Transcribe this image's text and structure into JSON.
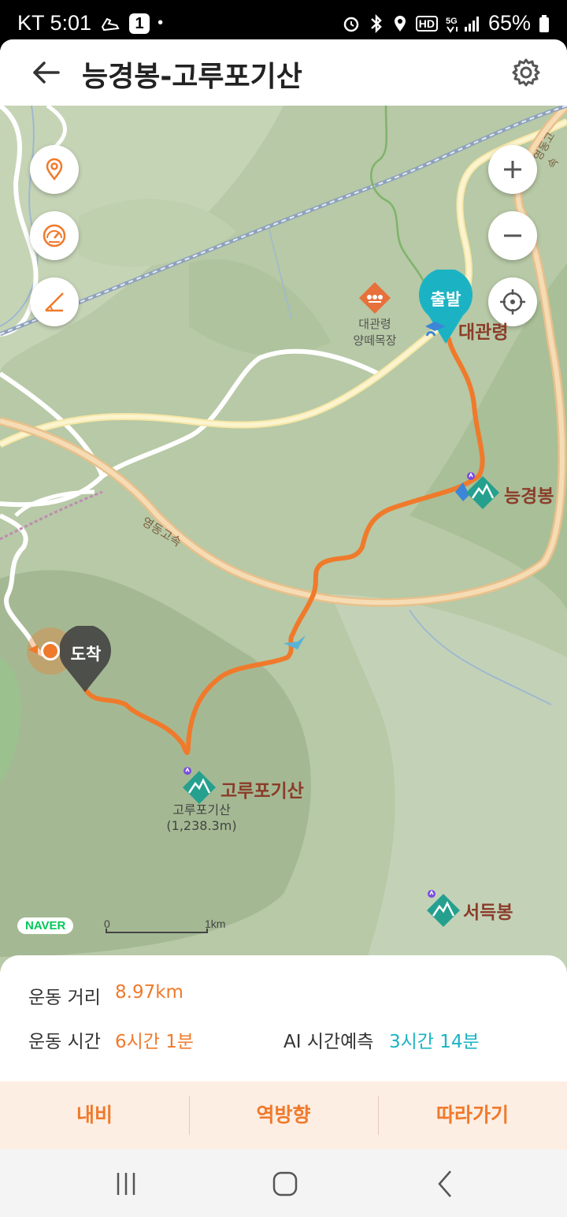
{
  "status_bar": {
    "carrier_time": "KT 5:01",
    "notification_count": "1",
    "network": "HD",
    "battery": "65%"
  },
  "header": {
    "title": "능경봉-고루포기산"
  },
  "map": {
    "labels": {
      "start_badge": "출발",
      "end_badge": "도착",
      "daegwallyeong": "대관령",
      "ranch_line1": "대관령",
      "ranch_line2": "양떼목장",
      "neunggyeongbong": "능경봉",
      "gorupogisan": "고루포기산",
      "gorupogisan_sub1": "고루포기산",
      "gorupogisan_sub2": "(1,238.3m)",
      "seodeukbong": "서득봉",
      "highway": "영동고속",
      "highway_right": "영동고속",
      "naver_logo": "NAVER",
      "scale_zero": "0",
      "scale_km": "1km"
    }
  },
  "stats": {
    "distance_label": "운동 거리",
    "distance_value": "8.97km",
    "time_label": "운동 시간",
    "time_value": "6시간 1분",
    "ai_label": "AI 시간예측",
    "ai_value": "3시간 14분"
  },
  "actions": {
    "navi": "내비",
    "reverse": "역방향",
    "follow": "따라가기"
  },
  "colors": {
    "route": "#f07a2b",
    "accent_teal": "#1bb3c4",
    "mountain_marker": "#25a08f"
  }
}
